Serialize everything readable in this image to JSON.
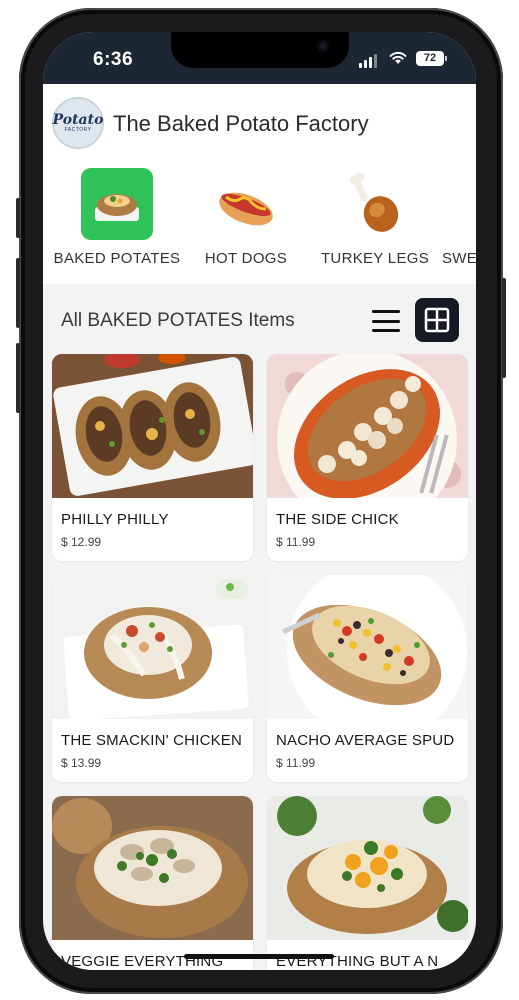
{
  "status": {
    "time": "6:36",
    "battery": "72"
  },
  "header": {
    "title": "The Baked Potato Factory",
    "logo_main": "Potato",
    "logo_sub": "FACTORY"
  },
  "categories": [
    {
      "label": "BAKED POTATES",
      "icon": "baked-potato-icon"
    },
    {
      "label": "HOT DOGS",
      "icon": "hotdog-icon"
    },
    {
      "label": "TURKEY LEGS",
      "icon": "turkey-leg-icon"
    },
    {
      "label": "SWE",
      "icon": "sweet-potato-icon"
    }
  ],
  "list": {
    "title": "All BAKED POTATES Items"
  },
  "items": [
    {
      "name": "PHILLY PHILLY",
      "price": "$ 12.99"
    },
    {
      "name": "THE SIDE CHICK",
      "price": "$ 11.99"
    },
    {
      "name": "THE SMACKIN' CHICKEN",
      "price": "$ 13.99"
    },
    {
      "name": "NACHO AVERAGE SPUD",
      "price": "$ 11.99"
    },
    {
      "name": "VEGGIE EVERYTHING",
      "price": ""
    },
    {
      "name": "EVERYTHING BUT A N",
      "price": ""
    }
  ],
  "colors": {
    "status_bg": "#1d2633",
    "selected_category_bg": "#2fc35a",
    "grid_toggle_bg": "#161a24"
  }
}
